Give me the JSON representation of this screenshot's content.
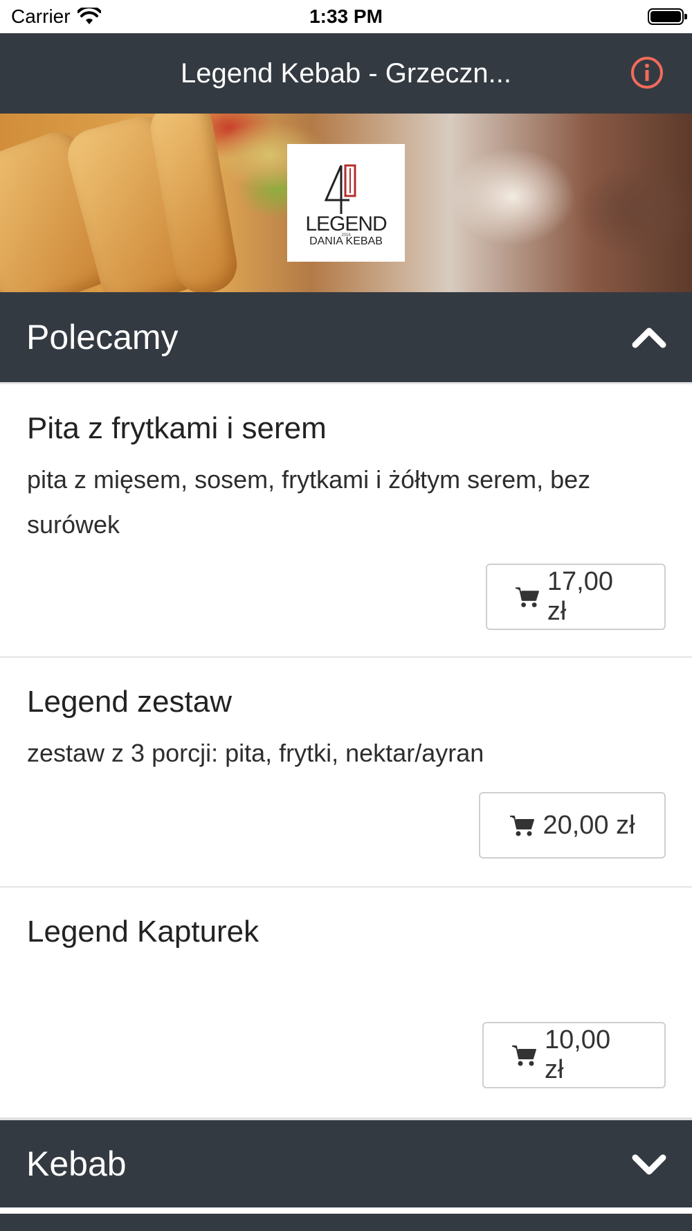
{
  "status_bar": {
    "carrier": "Carrier",
    "time": "1:33 PM"
  },
  "nav": {
    "title": "Legend Kebab - Grzeczn...",
    "info_icon": "info-circle-icon",
    "info_color": "#f26b5b"
  },
  "hero": {
    "logo": {
      "number": "4",
      "brand": "LEGEND",
      "year": "2016",
      "tagline": "DANIA KEBAB"
    }
  },
  "sections": [
    {
      "title": "Polecamy",
      "expanded": true,
      "items": [
        {
          "name": "Pita z frytkami i serem",
          "description": "pita z mięsem, sosem, frytkami i żółtym serem, bez surówek",
          "price": "17,00 zł"
        },
        {
          "name": "Legend zestaw",
          "description": "zestaw z 3 porcji: pita, frytki, nektar/ayran",
          "price": "20,00 zł"
        },
        {
          "name": "Legend Kapturek",
          "description": "",
          "price": "10,00 zł"
        }
      ]
    },
    {
      "title": "Kebab",
      "expanded": false,
      "items": []
    }
  ],
  "colors": {
    "header_bg": "#343a42",
    "text": "#222222",
    "border": "#cfcfcf"
  }
}
